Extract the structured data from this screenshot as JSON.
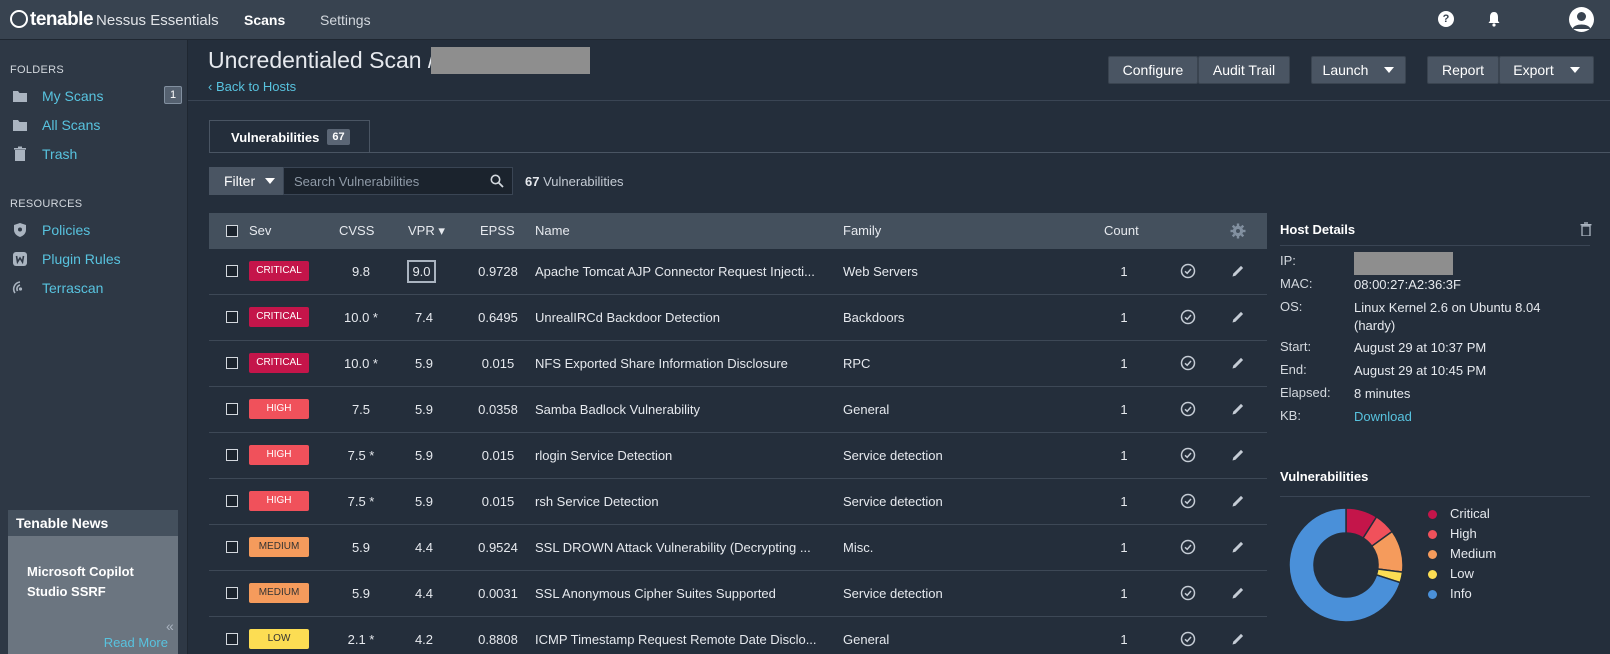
{
  "header": {
    "brand": "tenable",
    "product": "Nessus Essentials",
    "nav": [
      "Scans",
      "Settings"
    ],
    "help_icon": "help-icon",
    "notifications_icon": "bell-icon",
    "user_icon": "user-avatar-icon"
  },
  "sidebar": {
    "folders_heading": "FOLDERS",
    "folders": [
      {
        "label": "My Scans",
        "count": "1",
        "icon": "folder-icon"
      },
      {
        "label": "All Scans",
        "icon": "folder-icon"
      },
      {
        "label": "Trash",
        "icon": "trash-icon"
      }
    ],
    "resources_heading": "RESOURCES",
    "resources": [
      {
        "label": "Policies",
        "icon": "shield-icon"
      },
      {
        "label": "Plugin Rules",
        "icon": "plugin-icon"
      },
      {
        "label": "Terrascan",
        "icon": "radar-icon"
      }
    ],
    "news": {
      "heading": "Tenable News",
      "title": "Microsoft Copilot Studio SSRF",
      "read_more": "Read More"
    },
    "collapse_label": "«"
  },
  "page": {
    "title": "Uncredentialed Scan /",
    "back_link": "Back to Hosts",
    "buttons": {
      "configure": "Configure",
      "audit_trail": "Audit Trail",
      "launch": "Launch",
      "report": "Report",
      "export": "Export"
    }
  },
  "tabs": {
    "vulnerabilities_label": "Vulnerabilities",
    "vulnerabilities_count": "67"
  },
  "filter": {
    "button_label": "Filter",
    "search_placeholder": "Search Vulnerabilities",
    "count_bold": "67",
    "count_text": "Vulnerabilities"
  },
  "table": {
    "headers": {
      "sev": "Sev",
      "cvss": "CVSS",
      "vpr": "VPR ▾",
      "epss": "EPSS",
      "name": "Name",
      "family": "Family",
      "count": "Count"
    },
    "rows": [
      {
        "sev": "CRITICAL",
        "sev_class": "critical",
        "cvss": "9.8",
        "vpr": "9.0",
        "vpr_boxed": true,
        "epss": "0.9728",
        "name": "Apache Tomcat AJP Connector Request Injecti...",
        "family": "Web Servers",
        "count": "1"
      },
      {
        "sev": "CRITICAL",
        "sev_class": "critical",
        "cvss": "10.0 *",
        "vpr": "7.4",
        "epss": "0.6495",
        "name": "UnrealIRCd Backdoor Detection",
        "family": "Backdoors",
        "count": "1"
      },
      {
        "sev": "CRITICAL",
        "sev_class": "critical",
        "cvss": "10.0 *",
        "vpr": "5.9",
        "epss": "0.015",
        "name": "NFS Exported Share Information Disclosure",
        "family": "RPC",
        "count": "1"
      },
      {
        "sev": "HIGH",
        "sev_class": "high",
        "cvss": "7.5",
        "vpr": "5.9",
        "epss": "0.0358",
        "name": "Samba Badlock Vulnerability",
        "family": "General",
        "count": "1"
      },
      {
        "sev": "HIGH",
        "sev_class": "high",
        "cvss": "7.5 *",
        "vpr": "5.9",
        "epss": "0.015",
        "name": "rlogin Service Detection",
        "family": "Service detection",
        "count": "1"
      },
      {
        "sev": "HIGH",
        "sev_class": "high",
        "cvss": "7.5 *",
        "vpr": "5.9",
        "epss": "0.015",
        "name": "rsh Service Detection",
        "family": "Service detection",
        "count": "1"
      },
      {
        "sev": "MEDIUM",
        "sev_class": "medium",
        "cvss": "5.9",
        "vpr": "4.4",
        "epss": "0.9524",
        "name": "SSL DROWN Attack Vulnerability (Decrypting ...",
        "family": "Misc.",
        "count": "1"
      },
      {
        "sev": "MEDIUM",
        "sev_class": "medium",
        "cvss": "5.9",
        "vpr": "4.4",
        "epss": "0.0031",
        "name": "SSL Anonymous Cipher Suites Supported",
        "family": "Service detection",
        "count": "1"
      },
      {
        "sev": "LOW",
        "sev_class": "low",
        "cvss": "2.1 *",
        "vpr": "4.2",
        "epss": "0.8808",
        "name": "ICMP Timestamp Request Remote Date Disclo...",
        "family": "General",
        "count": "1"
      }
    ]
  },
  "host_details": {
    "heading": "Host Details",
    "fields": [
      {
        "key": "IP:",
        "value": ""
      },
      {
        "key": "MAC:",
        "value": "08:00:27:A2:36:3F"
      },
      {
        "key": "OS:",
        "value": "Linux Kernel 2.6 on Ubuntu 8.04 (hardy)"
      },
      {
        "key": "Start:",
        "value": "August 29 at 10:37 PM"
      },
      {
        "key": "End:",
        "value": "August 29 at 10:45 PM"
      },
      {
        "key": "Elapsed:",
        "value": "8 minutes"
      },
      {
        "key": "KB:",
        "value": "Download",
        "link": true
      }
    ],
    "vulnerabilities_heading": "Vulnerabilities",
    "legend": [
      {
        "label": "Critical",
        "color": "#c4154a"
      },
      {
        "label": "High",
        "color": "#f0515b"
      },
      {
        "label": "Medium",
        "color": "#f59b5c"
      },
      {
        "label": "Low",
        "color": "#fcdd53"
      },
      {
        "label": "Info",
        "color": "#4a90d9"
      }
    ],
    "donut_fractions": [
      0.09,
      0.06,
      0.12,
      0.03,
      0.7
    ]
  }
}
